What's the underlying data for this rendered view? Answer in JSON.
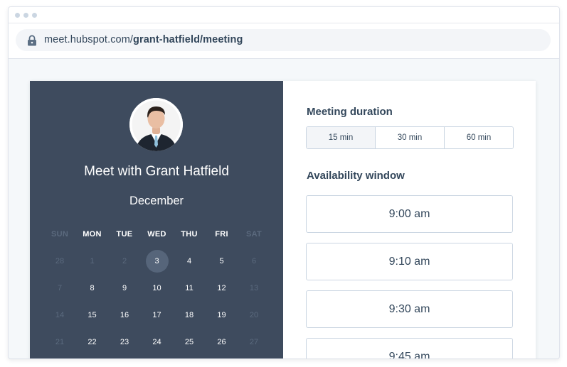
{
  "browser": {
    "url_prefix": "meet.hubspot.com/",
    "url_path": "grant-hatfield/meeting"
  },
  "host": {
    "title": "Meet with Grant Hatfield"
  },
  "calendar": {
    "month": "December",
    "weekdays": [
      "SUN",
      "MON",
      "TUE",
      "WED",
      "THU",
      "FRI",
      "SAT"
    ],
    "weeks": [
      [
        "28",
        "1",
        "2",
        "3",
        "4",
        "5",
        "6"
      ],
      [
        "7",
        "8",
        "9",
        "10",
        "11",
        "12",
        "13"
      ],
      [
        "14",
        "15",
        "16",
        "17",
        "18",
        "19",
        "20"
      ],
      [
        "21",
        "22",
        "23",
        "24",
        "25",
        "26",
        "27"
      ]
    ],
    "selected": "3"
  },
  "duration": {
    "title": "Meeting duration",
    "options": [
      "15 min",
      "30 min",
      "60 min"
    ],
    "selected": "15 min"
  },
  "availability": {
    "title": "Availability window",
    "slots": [
      "9:00 am",
      "9:10 am",
      "9:30 am",
      "9:45 am"
    ]
  },
  "colors": {
    "panel_dark": "#3e4b5e",
    "text_primary": "#33475b",
    "border": "#cbd6e2",
    "muted_day": "#5b6a7e",
    "selected_day": "#56657a"
  }
}
